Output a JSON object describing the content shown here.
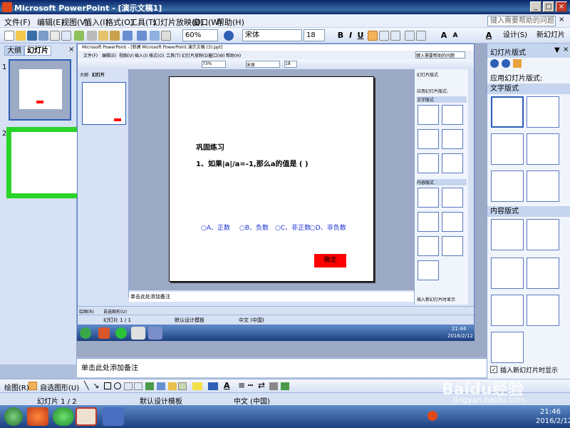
{
  "window": {
    "title": "Microsoft PowerPoint - [演示文稿1]"
  },
  "menu": [
    "文件(F)",
    "编辑(E)",
    "视图(V)",
    "插入(I)",
    "格式(O)",
    "工具(T)",
    "幻灯片放映(D)",
    "窗口(W)",
    "帮助(H)"
  ],
  "help_placeholder": "键入需要帮助的问题",
  "toolbar": {
    "zoom": "60%",
    "font": "宋体",
    "size": "18",
    "bold": "B",
    "italic": "I",
    "underline": "U",
    "shadow": "S",
    "design_label": "设计(S)",
    "new_slide_label": "新幻灯片(N)"
  },
  "left_pane": {
    "tab_outline": "大纲",
    "tab_slides": "幻灯片",
    "slide_nums": [
      "1",
      "2"
    ]
  },
  "inner_window": {
    "title": "Microsoft PowerPoint - [新建 Microsoft PowerPoint 演示文稿 (3).ppt]",
    "zoom": "73%",
    "font": "宋体",
    "size": "18",
    "help_placeholder": "键入需要帮助的问题",
    "notes": "单击此处添加备注",
    "status": [
      "幻灯片 1 / 1",
      "默认设计模板",
      "中文 (中国)"
    ],
    "clock": [
      "21:44",
      "2016/2/12"
    ],
    "task_title": "幻灯片版式",
    "apply_label": "应用幻灯片版式:",
    "text_layouts": "文字版式",
    "content_layouts": "内容版式",
    "show_on_insert": "插入新幻灯片时显示"
  },
  "slide": {
    "heading": "巩固练习",
    "question": "1、如果|a|/a=-1,那么a的值是 ( )",
    "options": [
      "○A、正数",
      "○B、负数",
      "○C、非正数",
      "○D、非负数"
    ],
    "confirm": "确定"
  },
  "task_pane": {
    "title": "幻灯片版式",
    "apply_label": "应用幻灯片版式:",
    "text_layouts": "文字版式",
    "content_layouts": "内容版式",
    "show_on_insert": "插入新幻灯片时显示"
  },
  "notes": "单击此处添加备注",
  "drawbar": {
    "draw": "绘图(R)",
    "autoshape": "自选图形(U)"
  },
  "status": {
    "slide": "幻灯片 1 / 2",
    "template": "默认设计模板",
    "lang": "中文 (中国)"
  },
  "clock": {
    "time": "21:46",
    "date": "2016/2/12"
  },
  "watermark": {
    "brand": "Baidu经验",
    "url": "jingyan.baidu.com"
  },
  "colors": {
    "accent": "#2d5fb5",
    "green_highlight": "#29d428",
    "confirm_red": "#ff0000",
    "option_blue": "#1a2fd6"
  }
}
